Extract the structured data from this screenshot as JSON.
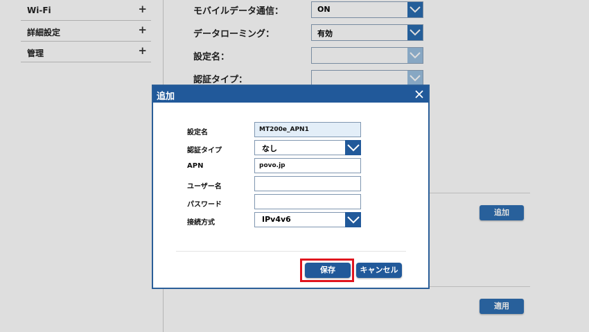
{
  "sidebar": {
    "items": [
      {
        "label": "Wi-Fi",
        "expand": "+"
      },
      {
        "label": "詳細設定",
        "expand": "+"
      },
      {
        "label": "管理",
        "expand": "+"
      }
    ]
  },
  "main": {
    "fields": [
      {
        "label": "モバイルデータ通信：",
        "value": "ON"
      },
      {
        "label": "データローミング：",
        "value": "有効"
      },
      {
        "label": "設定名：",
        "value": ""
      },
      {
        "label": "認証タイプ：",
        "value": ""
      }
    ],
    "add_button": "追加",
    "apply_button": "適用"
  },
  "dialog": {
    "title": "追加",
    "fields": {
      "profile_name": {
        "label": "設定名",
        "value": "MT200e_APN1"
      },
      "auth_type": {
        "label": "認証タイプ",
        "value": "なし"
      },
      "apn": {
        "label": "APN",
        "value": "povo.jp"
      },
      "username": {
        "label": "ユーザー名",
        "value": ""
      },
      "password": {
        "label": "パスワード",
        "value": ""
      },
      "connection": {
        "label": "接続方式",
        "value": "IPv4v6"
      }
    },
    "save_button": "保存",
    "cancel_button": "キャンセル"
  },
  "colors": {
    "accent": "#21599a",
    "highlight": "#e0141e"
  },
  "icons": [
    "plus-icon",
    "chevron-down-icon",
    "close-icon"
  ]
}
